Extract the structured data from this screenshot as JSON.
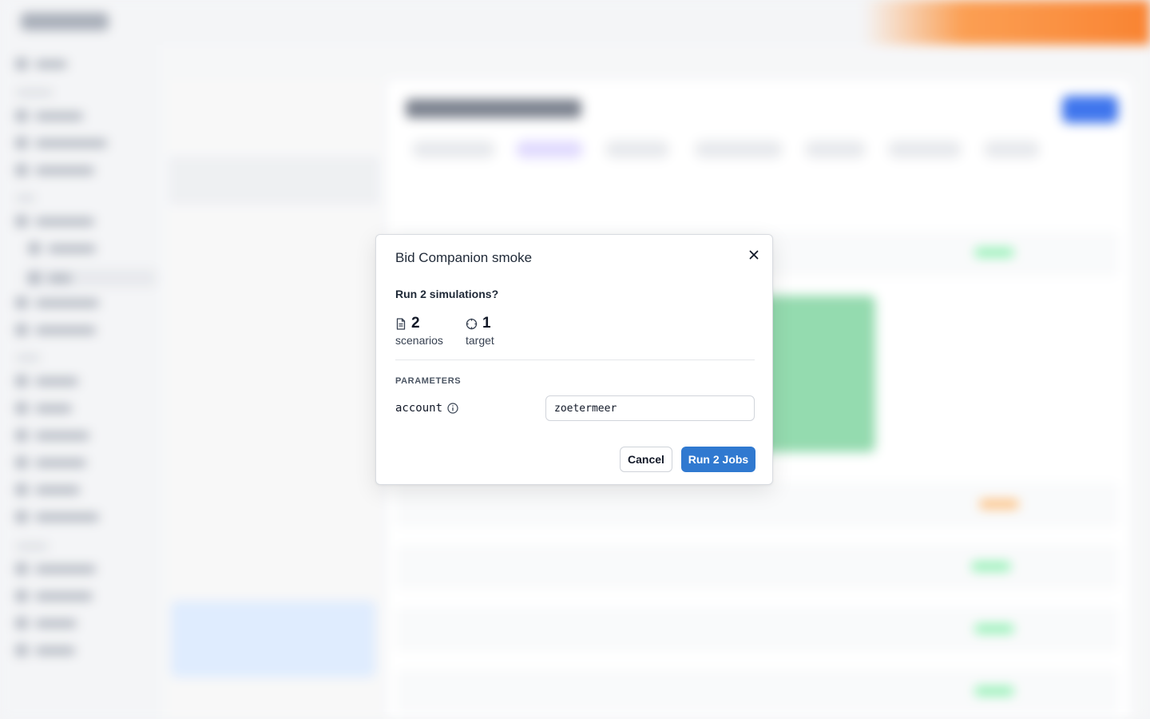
{
  "modal": {
    "title": "Bid Companion smoke",
    "question": "Run 2 simulations?",
    "stats": [
      {
        "value": "2",
        "label": "scenarios",
        "icon": "document-icon"
      },
      {
        "value": "1",
        "label": "target",
        "icon": "target-icon"
      }
    ],
    "parameters_heading": "PARAMETERS",
    "parameter": {
      "name": "account",
      "value": "zoetermeer"
    },
    "cancel_label": "Cancel",
    "run_label": "Run 2 Jobs"
  },
  "colors": {
    "primary": "#3079d0",
    "accent_orange": "#f97316",
    "success": "#86efac"
  }
}
